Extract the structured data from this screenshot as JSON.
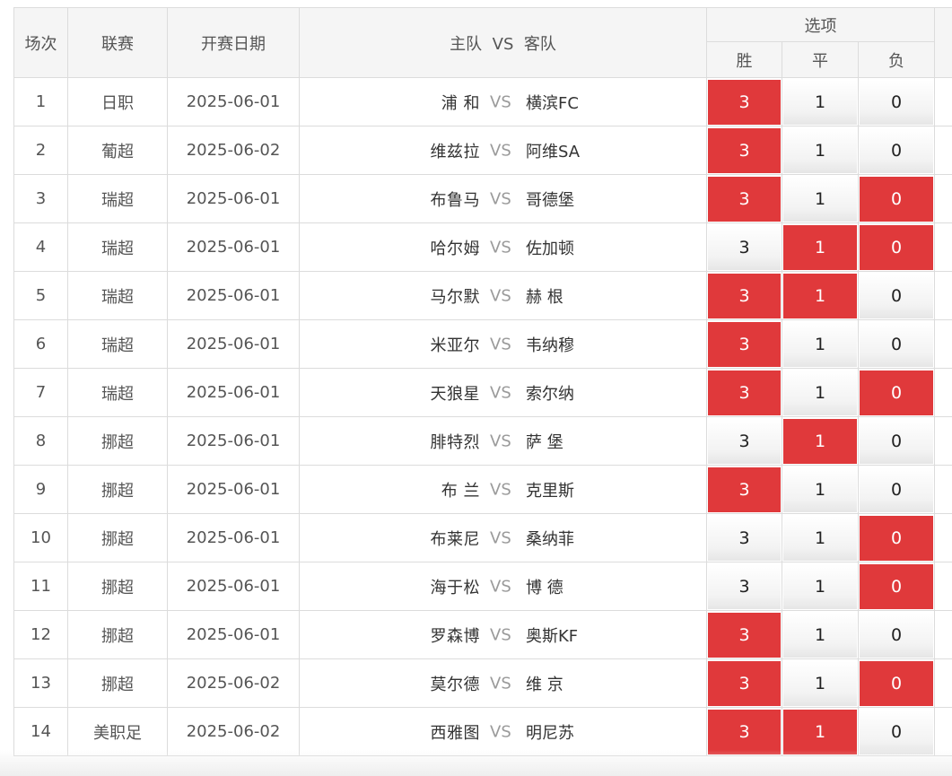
{
  "header": {
    "col_no": "场次",
    "col_league": "联赛",
    "col_date": "开赛日期",
    "col_home": "主队",
    "col_vs": "VS",
    "col_away": "客队",
    "col_options": "选项",
    "opt_win": "胜",
    "opt_draw": "平",
    "opt_lose": "负"
  },
  "colors": {
    "selected": "#e0393b",
    "border": "#dcdcdc",
    "header_bg": "#f5f5f5"
  },
  "rows": [
    {
      "no": "1",
      "league": "日职",
      "date": "2025-06-01",
      "home": "浦 和",
      "vs": "VS",
      "away": "横滨FC",
      "win": "3",
      "draw": "1",
      "lose": "0",
      "sel": [
        true,
        false,
        false
      ]
    },
    {
      "no": "2",
      "league": "葡超",
      "date": "2025-06-02",
      "home": "维兹拉",
      "vs": "VS",
      "away": "阿维SA",
      "win": "3",
      "draw": "1",
      "lose": "0",
      "sel": [
        true,
        false,
        false
      ]
    },
    {
      "no": "3",
      "league": "瑞超",
      "date": "2025-06-01",
      "home": "布鲁马",
      "vs": "VS",
      "away": "哥德堡",
      "win": "3",
      "draw": "1",
      "lose": "0",
      "sel": [
        true,
        false,
        true
      ]
    },
    {
      "no": "4",
      "league": "瑞超",
      "date": "2025-06-01",
      "home": "哈尔姆",
      "vs": "VS",
      "away": "佐加顿",
      "win": "3",
      "draw": "1",
      "lose": "0",
      "sel": [
        false,
        true,
        true
      ]
    },
    {
      "no": "5",
      "league": "瑞超",
      "date": "2025-06-01",
      "home": "马尔默",
      "vs": "VS",
      "away": "赫 根",
      "win": "3",
      "draw": "1",
      "lose": "0",
      "sel": [
        true,
        true,
        false
      ]
    },
    {
      "no": "6",
      "league": "瑞超",
      "date": "2025-06-01",
      "home": "米亚尔",
      "vs": "VS",
      "away": "韦纳穆",
      "win": "3",
      "draw": "1",
      "lose": "0",
      "sel": [
        true,
        false,
        false
      ]
    },
    {
      "no": "7",
      "league": "瑞超",
      "date": "2025-06-01",
      "home": "天狼星",
      "vs": "VS",
      "away": "索尔纳",
      "win": "3",
      "draw": "1",
      "lose": "0",
      "sel": [
        true,
        false,
        true
      ]
    },
    {
      "no": "8",
      "league": "挪超",
      "date": "2025-06-01",
      "home": "腓特烈",
      "vs": "VS",
      "away": "萨 堡",
      "win": "3",
      "draw": "1",
      "lose": "0",
      "sel": [
        false,
        true,
        false
      ]
    },
    {
      "no": "9",
      "league": "挪超",
      "date": "2025-06-01",
      "home": "布 兰",
      "vs": "VS",
      "away": "克里斯",
      "win": "3",
      "draw": "1",
      "lose": "0",
      "sel": [
        true,
        false,
        false
      ]
    },
    {
      "no": "10",
      "league": "挪超",
      "date": "2025-06-01",
      "home": "布莱尼",
      "vs": "VS",
      "away": "桑纳菲",
      "win": "3",
      "draw": "1",
      "lose": "0",
      "sel": [
        false,
        false,
        true
      ]
    },
    {
      "no": "11",
      "league": "挪超",
      "date": "2025-06-01",
      "home": "海于松",
      "vs": "VS",
      "away": "博 德",
      "win": "3",
      "draw": "1",
      "lose": "0",
      "sel": [
        false,
        false,
        true
      ]
    },
    {
      "no": "12",
      "league": "挪超",
      "date": "2025-06-01",
      "home": "罗森博",
      "vs": "VS",
      "away": "奥斯KF",
      "win": "3",
      "draw": "1",
      "lose": "0",
      "sel": [
        true,
        false,
        false
      ]
    },
    {
      "no": "13",
      "league": "挪超",
      "date": "2025-06-02",
      "home": "莫尔德",
      "vs": "VS",
      "away": "维 京",
      "win": "3",
      "draw": "1",
      "lose": "0",
      "sel": [
        true,
        false,
        true
      ]
    },
    {
      "no": "14",
      "league": "美职足",
      "date": "2025-06-02",
      "home": "西雅图",
      "vs": "VS",
      "away": "明尼苏",
      "win": "3",
      "draw": "1",
      "lose": "0",
      "sel": [
        true,
        true,
        false
      ]
    }
  ]
}
